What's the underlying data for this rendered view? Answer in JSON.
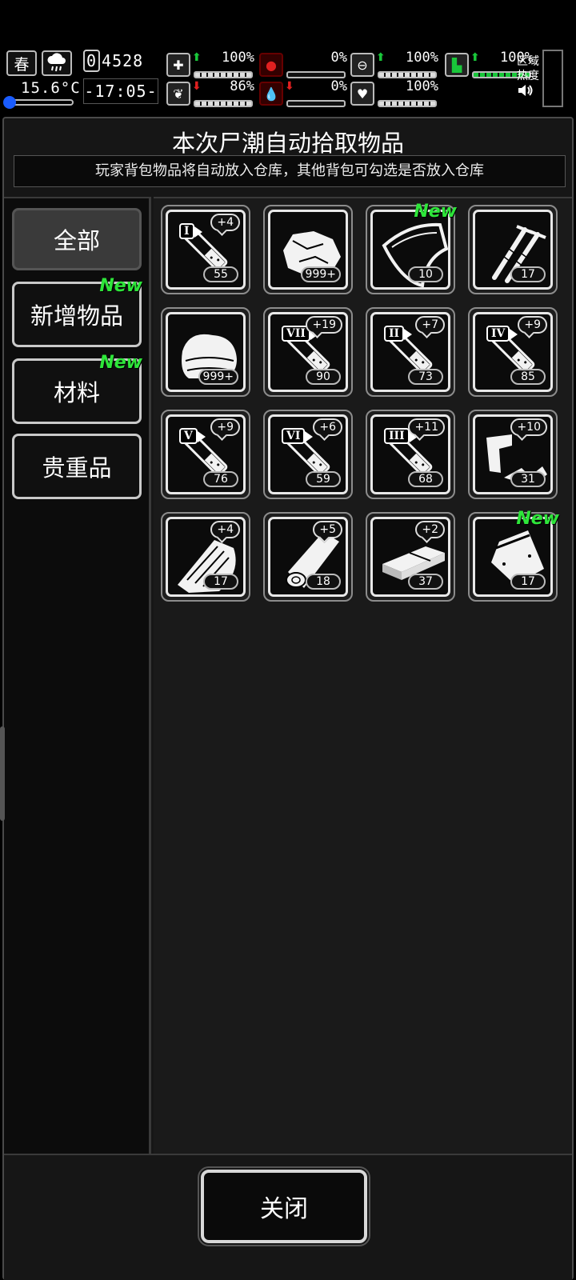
{
  "hud": {
    "season": "春",
    "temperature": "15.6°C",
    "day": "4528",
    "day_prefix": "0",
    "clock": "-17:05-",
    "stats": [
      {
        "name": "health",
        "icon": "medkit-icon",
        "glyph": "✚",
        "arrow": "⬆",
        "arrow_color": "#19c73a",
        "value": "100%",
        "bar": "full"
      },
      {
        "name": "hunger",
        "icon": "stomach-icon",
        "glyph": "●",
        "arrow": "",
        "arrow_color": "#e02020",
        "value": "0%",
        "bar": "empty"
      },
      {
        "name": "medicine",
        "icon": "pill-icon",
        "glyph": "⊖",
        "arrow": "⬆",
        "arrow_color": "#19c73a",
        "value": "100%",
        "bar": "full"
      },
      {
        "name": "stamina",
        "icon": "boot-icon",
        "glyph": "▙",
        "arrow": "⬆",
        "arrow_color": "#19c73a",
        "value": "100%",
        "bar": "green"
      },
      {
        "name": "sanity",
        "icon": "brain-icon",
        "glyph": "❦",
        "arrow": "⬇",
        "arrow_color": "#e02020",
        "value": "86%",
        "bar": "full"
      },
      {
        "name": "thirst",
        "icon": "blood-drop-icon",
        "glyph": "💧",
        "arrow": "⬇",
        "arrow_color": "#e02020",
        "value": "0%",
        "bar": "empty"
      },
      {
        "name": "mood",
        "icon": "heart-icon",
        "glyph": "♥",
        "arrow": "",
        "arrow_color": "#19c73a",
        "value": "100%",
        "bar": "full"
      }
    ],
    "region_label": "区域\n热度",
    "region_line1": "区域",
    "region_line2": "热度",
    "sound_icon": "🔊"
  },
  "panel": {
    "title": "本次尸潮自动拾取物品",
    "subtitle": "玩家背包物品将自动放入仓库，其他背包可勾选是否放入仓库"
  },
  "categories": [
    {
      "label": "全部",
      "active": true,
      "new": ""
    },
    {
      "label": "新增物品",
      "active": false,
      "new": "New"
    },
    {
      "label": "材料",
      "active": false,
      "new": "New"
    },
    {
      "label": "贵重品",
      "active": false,
      "new": ""
    }
  ],
  "items": [
    {
      "type": "syringe",
      "roman": "I",
      "plus": "+4",
      "count": "55",
      "new": ""
    },
    {
      "type": "rock",
      "roman": "",
      "plus": "",
      "count": "999+",
      "new": ""
    },
    {
      "type": "cloth",
      "roman": "",
      "plus": "",
      "count": "10",
      "new": "New"
    },
    {
      "type": "screws",
      "roman": "",
      "plus": "",
      "count": "17",
      "new": ""
    },
    {
      "type": "towel",
      "roman": "",
      "plus": "",
      "count": "999+",
      "new": ""
    },
    {
      "type": "syringe",
      "roman": "VII",
      "plus": "+19",
      "count": "90",
      "new": ""
    },
    {
      "type": "syringe",
      "roman": "II",
      "plus": "+7",
      "count": "73",
      "new": ""
    },
    {
      "type": "syringe",
      "roman": "IV",
      "plus": "+9",
      "count": "85",
      "new": ""
    },
    {
      "type": "syringe",
      "roman": "V",
      "plus": "+9",
      "count": "76",
      "new": ""
    },
    {
      "type": "syringe",
      "roman": "VI",
      "plus": "+6",
      "count": "59",
      "new": ""
    },
    {
      "type": "syringe",
      "roman": "III",
      "plus": "+11",
      "count": "68",
      "new": ""
    },
    {
      "type": "scrap",
      "roman": "",
      "plus": "+10",
      "count": "31",
      "new": ""
    },
    {
      "type": "wood",
      "roman": "",
      "plus": "+4",
      "count": "17",
      "new": ""
    },
    {
      "type": "log",
      "roman": "",
      "plus": "+5",
      "count": "18",
      "new": ""
    },
    {
      "type": "board",
      "roman": "",
      "plus": "+2",
      "count": "37",
      "new": ""
    },
    {
      "type": "bag",
      "roman": "",
      "plus": "",
      "count": "17",
      "new": "New"
    }
  ],
  "footer": {
    "close_label": "关闭"
  }
}
